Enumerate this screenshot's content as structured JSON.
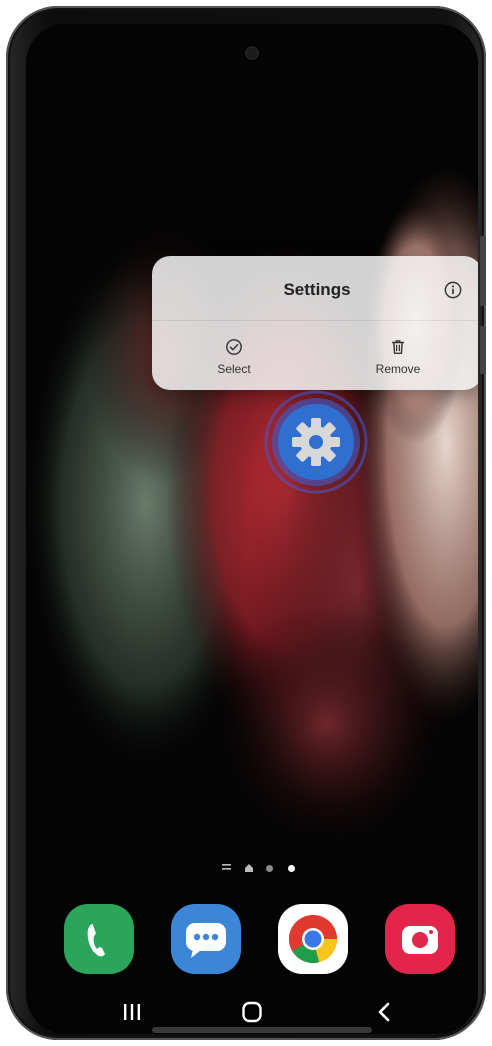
{
  "context_menu": {
    "title": "Settings",
    "info_icon": "info-icon",
    "actions": [
      {
        "label": "Select",
        "icon": "check-circle-icon"
      },
      {
        "label": "Remove",
        "icon": "trash-icon"
      }
    ]
  },
  "home_screen": {
    "focused_app": {
      "name": "Settings",
      "icon": "gear-icon"
    },
    "page_indicator": {
      "pages": 3,
      "current": 3
    },
    "dock": [
      {
        "name": "Phone",
        "icon": "phone-icon",
        "color": "#2aa55b"
      },
      {
        "name": "Messages",
        "icon": "chat-bubble-icon",
        "color": "#3b86d6"
      },
      {
        "name": "Chrome",
        "icon": "chrome-icon",
        "color": "#ffffff"
      },
      {
        "name": "Camera",
        "icon": "camera-icon",
        "color": "#e4254b"
      }
    ]
  },
  "navigation_bar": {
    "buttons": [
      {
        "name": "recent-apps",
        "icon": "recents-icon"
      },
      {
        "name": "home",
        "icon": "home-icon"
      },
      {
        "name": "back",
        "icon": "back-icon"
      }
    ]
  },
  "colors": {
    "menu_background": "#f2f2f2",
    "settings_icon_blue": "#2f6fd0",
    "selection_ring": "#3f5bd6"
  }
}
